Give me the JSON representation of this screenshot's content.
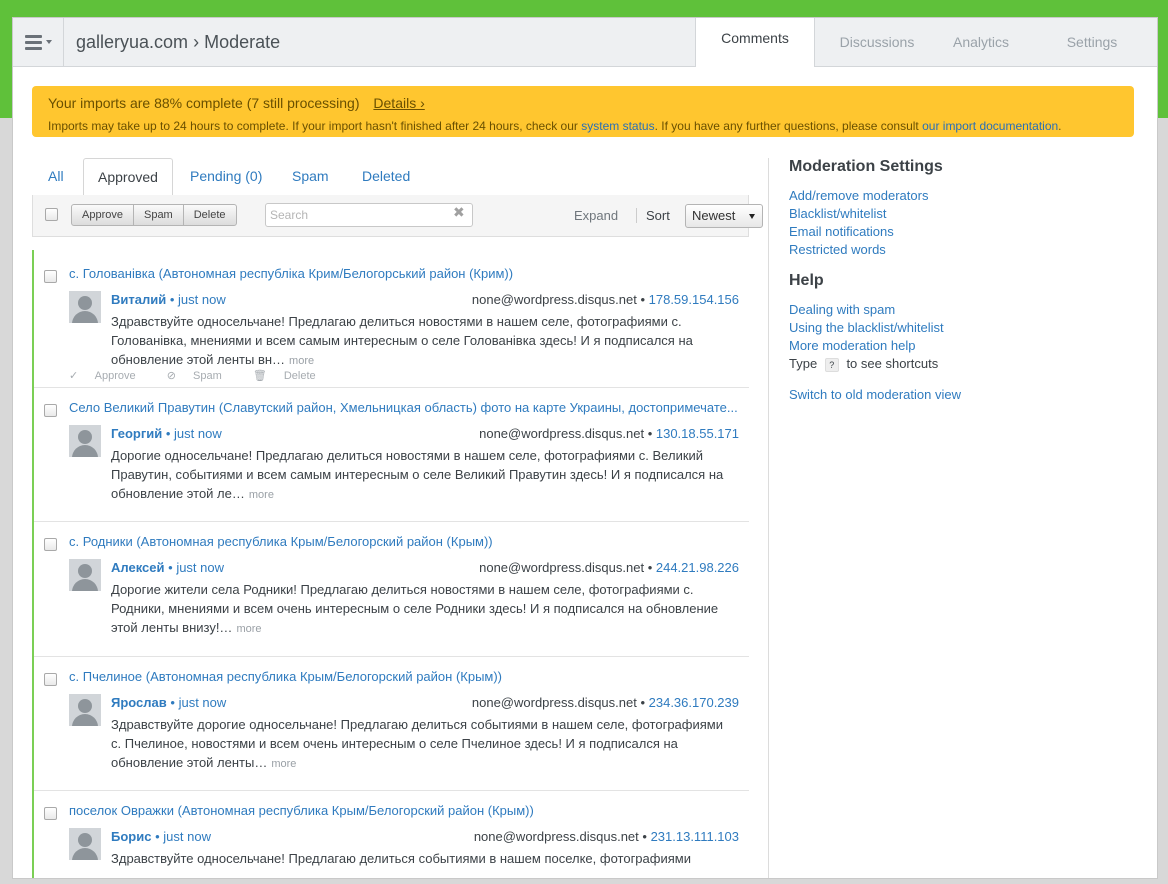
{
  "header": {
    "site": "galleryua.com",
    "separator": "›",
    "page": "Moderate",
    "tabs": [
      "Comments",
      "Discussions",
      "Analytics",
      "Settings"
    ]
  },
  "banner": {
    "title": "Your imports are 88% complete (7 still processing)",
    "details": "Details ›",
    "line2_a": "Imports may take up to 24 hours to complete. If your import hasn't finished after 24 hours, check our ",
    "link1": "system status",
    "line2_b": ". If you have any further questions, please consult ",
    "link2": "our import documentation",
    "line2_c": "."
  },
  "filters": [
    "All",
    "Approved",
    "Pending (0)",
    "Spam",
    "Deleted"
  ],
  "toolbar": {
    "approve": "Approve",
    "spam": "Spam",
    "delete": "Delete",
    "search_placeholder": "Search",
    "clear": "✖",
    "expand": "Expand",
    "sort_label": "Sort",
    "sort_value": "Newest"
  },
  "comments": [
    {
      "title": "с. Голованівка (Автономная республіка Крим/Белогорський район (Крим))",
      "author": "Виталий",
      "time": "just now",
      "email": "none@wordpress.disqus.net",
      "ip": "178.59.154.156",
      "body": "Здравствуйте односельчане! Предлагаю делиться новостями в нашем селе, фотографиями с. Голованівка, мнениями и всем самым интересным о селе Голованівка здесь! И я подписался на обновление этой ленты вн…",
      "more": "more"
    },
    {
      "title": "Село Великий Правутин (Славутский район, Хмельницкая область) фото на карте Украины, достопримечате...",
      "author": "Георгий",
      "time": "just now",
      "email": "none@wordpress.disqus.net",
      "ip": "130.18.55.171",
      "body": "Дорогие односельчане! Предлагаю делиться новостями в нашем селе, фотографиями с. Великий Правутин, событиями и всем самым интересным о селе Великий Правутин здесь! И я подписался на обновление этой ле…",
      "more": "more"
    },
    {
      "title": "с. Родники (Автономная республика Крым/Белогорский район (Крым))",
      "author": "Алексей",
      "time": "just now",
      "email": "none@wordpress.disqus.net",
      "ip": "244.21.98.226",
      "body": "Дорогие жители села Родники! Предлагаю делиться новостями в нашем селе, фотографиями с. Родники, мнениями и всем очень интересным о селе Родники здесь! И я подписался на обновление этой ленты внизу!…",
      "more": "more"
    },
    {
      "title": "с. Пчелиное (Автономная республика Крым/Белогорский район (Крым))",
      "author": "Ярослав",
      "time": "just now",
      "email": "none@wordpress.disqus.net",
      "ip": "234.36.170.239",
      "body": "Здравствуйте дорогие односельчане! Предлагаю делиться событиями в нашем селе, фотографиями с. Пчелиное, новостями и всем очень интересным о селе Пчелиное здесь! И я подписался на обновление этой ленты…",
      "more": "more"
    },
    {
      "title": "поселок Овражки (Автономная республика Крым/Белогорский район (Крым))",
      "author": "Борис",
      "time": "just now",
      "email": "none@wordpress.disqus.net",
      "ip": "231.13.111.103",
      "body": "Здравствуйте односельчане! Предлагаю делиться событиями в нашем поселке, фотографиями",
      "more": ""
    }
  ],
  "row_actions": [
    "Approve",
    "Spam",
    "Delete"
  ],
  "sidebar": {
    "moderation_title": "Moderation Settings",
    "moderation_links": [
      "Add/remove moderators",
      "Blacklist/whitelist",
      "Email notifications",
      "Restricted words"
    ],
    "help_title": "Help",
    "help_links": [
      "Dealing with spam",
      "Using the blacklist/whitelist",
      "More moderation help"
    ],
    "shortcut_type": "Type",
    "shortcut_key": "?",
    "shortcut_rest": "to see shortcuts",
    "switch_link": "Switch to old moderation view"
  }
}
